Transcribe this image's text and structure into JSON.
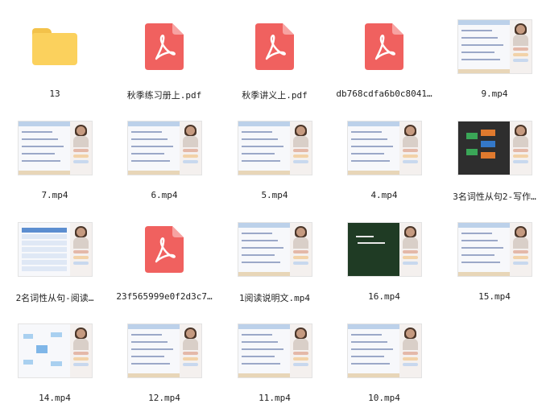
{
  "files": [
    {
      "name": "13",
      "type": "folder"
    },
    {
      "name": "秋季练习册上.pdf",
      "type": "pdf"
    },
    {
      "name": "秋季讲义上.pdf",
      "type": "pdf"
    },
    {
      "name": "db768cdfa6b0c8041…",
      "type": "pdf"
    },
    {
      "name": "9.mp4",
      "type": "video",
      "style": "light"
    },
    {
      "name": "7.mp4",
      "type": "video",
      "style": "light"
    },
    {
      "name": "6.mp4",
      "type": "video",
      "style": "light"
    },
    {
      "name": "5.mp4",
      "type": "video",
      "style": "light"
    },
    {
      "name": "4.mp4",
      "type": "video",
      "style": "light"
    },
    {
      "name": "3名词性从句2-写作…",
      "type": "video",
      "style": "dark"
    },
    {
      "name": "2名词性从句-阅读…",
      "type": "video",
      "style": "table"
    },
    {
      "name": "23f565999e0f2d3c7…",
      "type": "pdf"
    },
    {
      "name": "1阅读说明文.mp4",
      "type": "video",
      "style": "light"
    },
    {
      "name": "16.mp4",
      "type": "video",
      "style": "board"
    },
    {
      "name": "15.mp4",
      "type": "video",
      "style": "light"
    },
    {
      "name": "14.mp4",
      "type": "video",
      "style": "map"
    },
    {
      "name": "12.mp4",
      "type": "video",
      "style": "light"
    },
    {
      "name": "11.mp4",
      "type": "video",
      "style": "light"
    },
    {
      "name": "10.mp4",
      "type": "video",
      "style": "light"
    }
  ],
  "colors": {
    "folder": "#fbd15d",
    "pdf": "#f0615f",
    "board": "#1f3b24",
    "dark_slide": "#2e2e2e"
  }
}
